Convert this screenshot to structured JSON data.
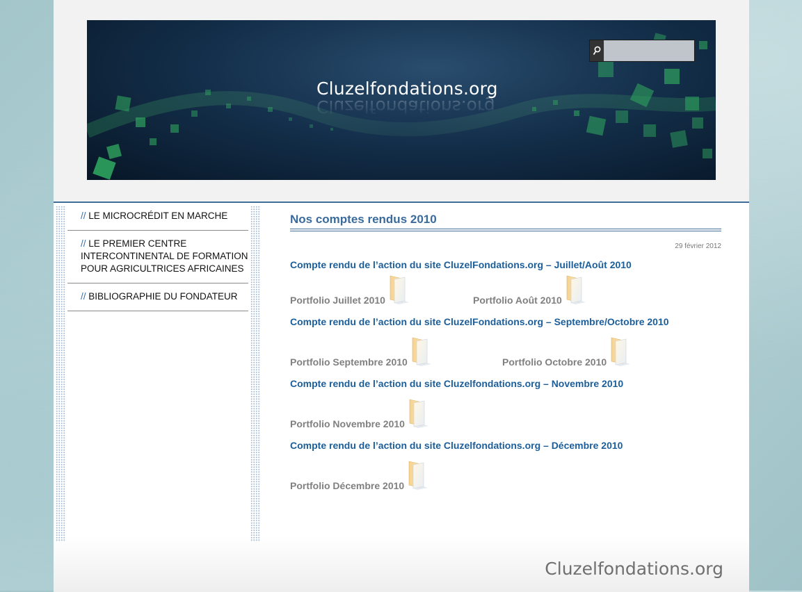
{
  "header": {
    "site_title": "Cluzelfondations.org",
    "search": {
      "placeholder": ""
    }
  },
  "sidebar": {
    "items": [
      {
        "prefix": "//",
        "label": "LE MICROCRÉDIT EN MARCHE"
      },
      {
        "prefix": "//",
        "label": "LE PREMIER CENTRE INTERCONTINENTAL DE FORMATION POUR AGRICULTRICES  AFRICAINES"
      },
      {
        "prefix": "//",
        "label": "BIBLIOGRAPHIE DU FONDATEUR"
      }
    ]
  },
  "main": {
    "title": "Nos comptes rendus 2010",
    "date": "29 février 2012",
    "reports": [
      {
        "title": "Compte rendu de l’action du site CluzelFondations.org – Juillet/Août 2010",
        "portfolios": [
          "Portfolio Juillet 2010",
          "Portfolio Août 2010"
        ]
      },
      {
        "title": "Compte rendu de l’action du site CluzelFondations.org – Septembre/Octobre 2010",
        "portfolios": [
          "Portfolio Septembre 2010",
          "Portfolio Octobre 2010"
        ]
      },
      {
        "title": "Compte rendu de l’action du site Cluzelfondations.org – Novembre 2010",
        "portfolios": [
          "Portfolio Novembre 2010"
        ]
      },
      {
        "title": "Compte rendu de l’action du site Cluzelfondations.org – Décembre 2010",
        "portfolios": [
          "Portfolio Décembre 2010"
        ]
      }
    ]
  },
  "footer": {
    "logo_text": "Cluzelfondations.org"
  },
  "colors": {
    "accent": "#3f6c9b",
    "link": "#1b5e9a",
    "portfolio": "#808080"
  },
  "icons": {
    "search": "search-icon",
    "folder": "folder-icon"
  }
}
